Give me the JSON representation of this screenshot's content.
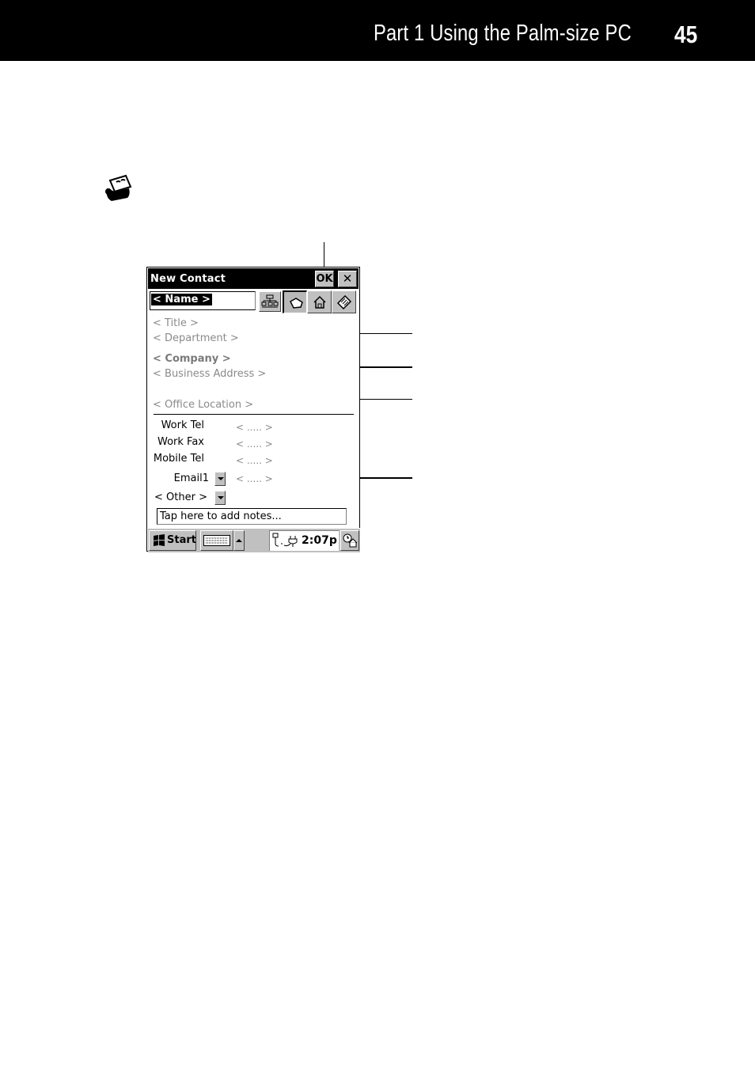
{
  "page_header": {
    "title": "Part 1  Using the Palm-size PC",
    "page_number": "45"
  },
  "note_icon": "rolodex-card-icon",
  "device": {
    "window_title": "New Contact",
    "ok_label": "OK",
    "close_label": "✕",
    "name_field": "< Name >",
    "tabs": [
      {
        "name": "business",
        "icon": "briefcase-icon",
        "active": true
      },
      {
        "name": "home",
        "icon": "house-icon",
        "active": false
      },
      {
        "name": "notes",
        "icon": "tag-icon",
        "active": false
      }
    ],
    "fields": {
      "title": "< Title >",
      "department": "< Department >",
      "company": "< Company >",
      "business_address": "< Business Address >",
      "office_location": "< Office Location >"
    },
    "phone_rows": [
      {
        "label": "Work Tel",
        "value": "< ..... >"
      },
      {
        "label": "Work Fax",
        "value": "< ..... >"
      },
      {
        "label": "Mobile Tel",
        "value": "< ..... >"
      },
      {
        "label": "Email1",
        "value": "< ..... >",
        "dropdown": true
      },
      {
        "label": "< Other >",
        "value": "",
        "dropdown": true
      }
    ],
    "notes_placeholder": "Tap here to add notes...",
    "taskbar": {
      "start_label": "Start",
      "clock": "2:07p"
    }
  }
}
